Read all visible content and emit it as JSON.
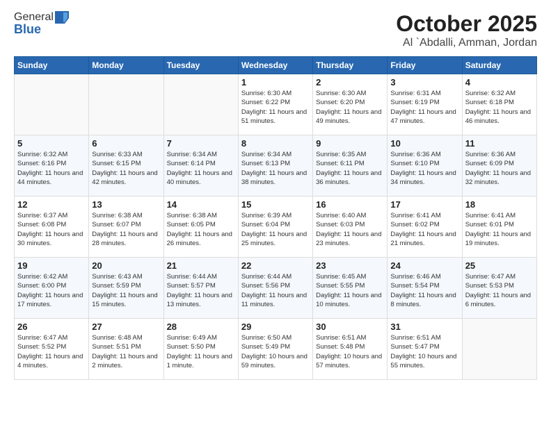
{
  "logo": {
    "line1": "General",
    "line2": "Blue"
  },
  "header": {
    "month": "October 2025",
    "location": "Al `Abdalli, Amman, Jordan"
  },
  "weekdays": [
    "Sunday",
    "Monday",
    "Tuesday",
    "Wednesday",
    "Thursday",
    "Friday",
    "Saturday"
  ],
  "weeks": [
    [
      {
        "day": "",
        "empty": true
      },
      {
        "day": "",
        "empty": true
      },
      {
        "day": "",
        "empty": true
      },
      {
        "day": "1",
        "sunrise": "6:30 AM",
        "sunset": "6:22 PM",
        "daylight": "11 hours and 51 minutes."
      },
      {
        "day": "2",
        "sunrise": "6:30 AM",
        "sunset": "6:20 PM",
        "daylight": "11 hours and 49 minutes."
      },
      {
        "day": "3",
        "sunrise": "6:31 AM",
        "sunset": "6:19 PM",
        "daylight": "11 hours and 47 minutes."
      },
      {
        "day": "4",
        "sunrise": "6:32 AM",
        "sunset": "6:18 PM",
        "daylight": "11 hours and 46 minutes."
      }
    ],
    [
      {
        "day": "5",
        "sunrise": "6:32 AM",
        "sunset": "6:16 PM",
        "daylight": "11 hours and 44 minutes."
      },
      {
        "day": "6",
        "sunrise": "6:33 AM",
        "sunset": "6:15 PM",
        "daylight": "11 hours and 42 minutes."
      },
      {
        "day": "7",
        "sunrise": "6:34 AM",
        "sunset": "6:14 PM",
        "daylight": "11 hours and 40 minutes."
      },
      {
        "day": "8",
        "sunrise": "6:34 AM",
        "sunset": "6:13 PM",
        "daylight": "11 hours and 38 minutes."
      },
      {
        "day": "9",
        "sunrise": "6:35 AM",
        "sunset": "6:11 PM",
        "daylight": "11 hours and 36 minutes."
      },
      {
        "day": "10",
        "sunrise": "6:36 AM",
        "sunset": "6:10 PM",
        "daylight": "11 hours and 34 minutes."
      },
      {
        "day": "11",
        "sunrise": "6:36 AM",
        "sunset": "6:09 PM",
        "daylight": "11 hours and 32 minutes."
      }
    ],
    [
      {
        "day": "12",
        "sunrise": "6:37 AM",
        "sunset": "6:08 PM",
        "daylight": "11 hours and 30 minutes."
      },
      {
        "day": "13",
        "sunrise": "6:38 AM",
        "sunset": "6:07 PM",
        "daylight": "11 hours and 28 minutes."
      },
      {
        "day": "14",
        "sunrise": "6:38 AM",
        "sunset": "6:05 PM",
        "daylight": "11 hours and 26 minutes."
      },
      {
        "day": "15",
        "sunrise": "6:39 AM",
        "sunset": "6:04 PM",
        "daylight": "11 hours and 25 minutes."
      },
      {
        "day": "16",
        "sunrise": "6:40 AM",
        "sunset": "6:03 PM",
        "daylight": "11 hours and 23 minutes."
      },
      {
        "day": "17",
        "sunrise": "6:41 AM",
        "sunset": "6:02 PM",
        "daylight": "11 hours and 21 minutes."
      },
      {
        "day": "18",
        "sunrise": "6:41 AM",
        "sunset": "6:01 PM",
        "daylight": "11 hours and 19 minutes."
      }
    ],
    [
      {
        "day": "19",
        "sunrise": "6:42 AM",
        "sunset": "6:00 PM",
        "daylight": "11 hours and 17 minutes."
      },
      {
        "day": "20",
        "sunrise": "6:43 AM",
        "sunset": "5:59 PM",
        "daylight": "11 hours and 15 minutes."
      },
      {
        "day": "21",
        "sunrise": "6:44 AM",
        "sunset": "5:57 PM",
        "daylight": "11 hours and 13 minutes."
      },
      {
        "day": "22",
        "sunrise": "6:44 AM",
        "sunset": "5:56 PM",
        "daylight": "11 hours and 11 minutes."
      },
      {
        "day": "23",
        "sunrise": "6:45 AM",
        "sunset": "5:55 PM",
        "daylight": "11 hours and 10 minutes."
      },
      {
        "day": "24",
        "sunrise": "6:46 AM",
        "sunset": "5:54 PM",
        "daylight": "11 hours and 8 minutes."
      },
      {
        "day": "25",
        "sunrise": "6:47 AM",
        "sunset": "5:53 PM",
        "daylight": "11 hours and 6 minutes."
      }
    ],
    [
      {
        "day": "26",
        "sunrise": "6:47 AM",
        "sunset": "5:52 PM",
        "daylight": "11 hours and 4 minutes."
      },
      {
        "day": "27",
        "sunrise": "6:48 AM",
        "sunset": "5:51 PM",
        "daylight": "11 hours and 2 minutes."
      },
      {
        "day": "28",
        "sunrise": "6:49 AM",
        "sunset": "5:50 PM",
        "daylight": "11 hours and 1 minute."
      },
      {
        "day": "29",
        "sunrise": "6:50 AM",
        "sunset": "5:49 PM",
        "daylight": "10 hours and 59 minutes."
      },
      {
        "day": "30",
        "sunrise": "6:51 AM",
        "sunset": "5:48 PM",
        "daylight": "10 hours and 57 minutes."
      },
      {
        "day": "31",
        "sunrise": "6:51 AM",
        "sunset": "5:47 PM",
        "daylight": "10 hours and 55 minutes."
      },
      {
        "day": "",
        "empty": true
      }
    ]
  ]
}
